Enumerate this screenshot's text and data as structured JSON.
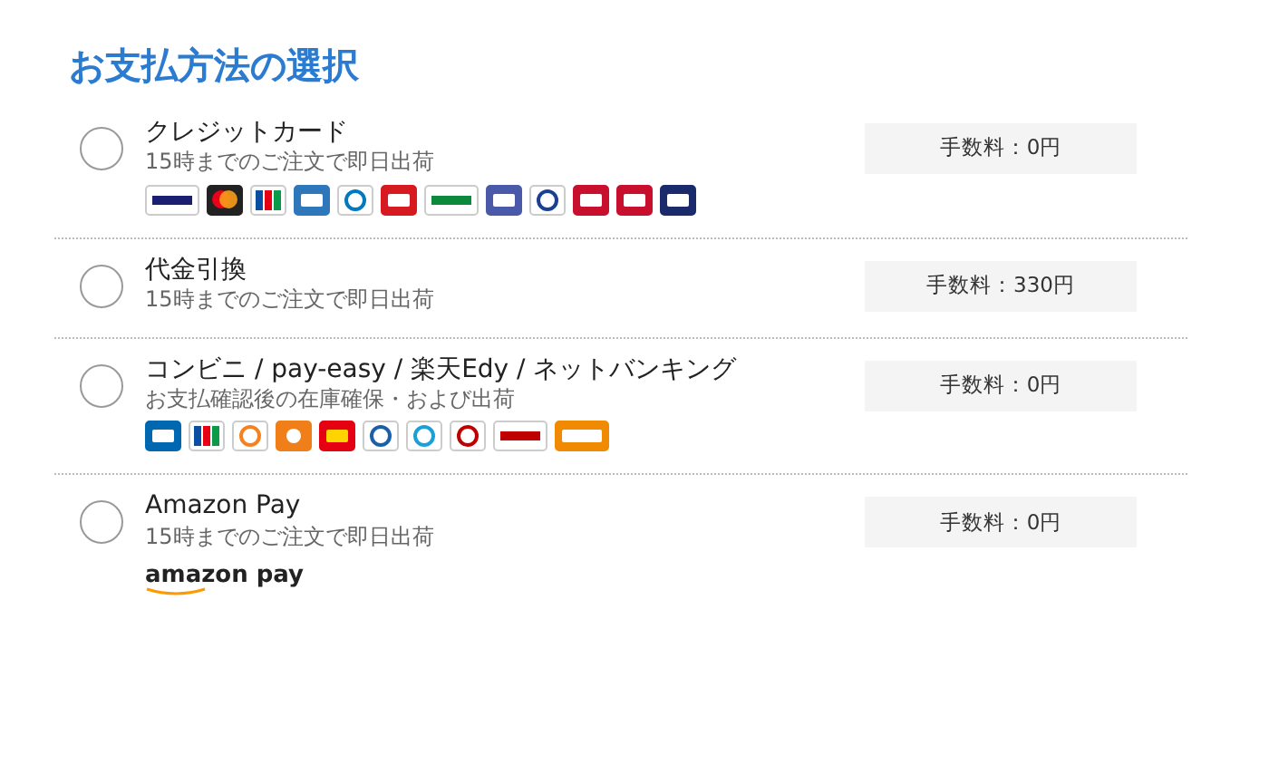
{
  "title": "お支払方法の選択",
  "methods": [
    {
      "name": "クレジットカード",
      "note": "15時までのご注文で即日出荷",
      "fee": "手数料：0円",
      "selected": false,
      "logos": [
        {
          "kind": "visa"
        },
        {
          "kind": "master"
        },
        {
          "kind": "jcb"
        },
        {
          "kind": "amex"
        },
        {
          "kind": "diners"
        },
        {
          "kind": "dc"
        },
        {
          "kind": "jaccs"
        },
        {
          "kind": "aeon"
        },
        {
          "kind": "cedyna"
        },
        {
          "kind": "ufj"
        },
        {
          "kind": "nicos"
        },
        {
          "kind": "omc"
        }
      ]
    },
    {
      "name": "代金引換",
      "note": "15時までのご注文で即日出荷",
      "fee": "手数料：330円",
      "selected": false
    },
    {
      "name": "コンビニ / pay-easy / 楽天Edy / ネットバンキング",
      "note": "お支払確認後の在庫確保・および出荷",
      "fee": "手数料：0円",
      "selected": false,
      "logos": [
        {
          "kind": "lawson"
        },
        {
          "kind": "familymart"
        },
        {
          "kind": "seven"
        },
        {
          "kind": "ministop"
        },
        {
          "kind": "daily"
        },
        {
          "kind": "seicomart"
        },
        {
          "kind": "payeasy"
        },
        {
          "kind": "edy"
        },
        {
          "kind": "rakuten"
        },
        {
          "kind": "bank"
        }
      ]
    },
    {
      "name": "Amazon Pay",
      "note": "15時までのご注文で即日出荷",
      "fee": "手数料：0円",
      "selected": false,
      "logo_text": "amazon pay"
    }
  ]
}
